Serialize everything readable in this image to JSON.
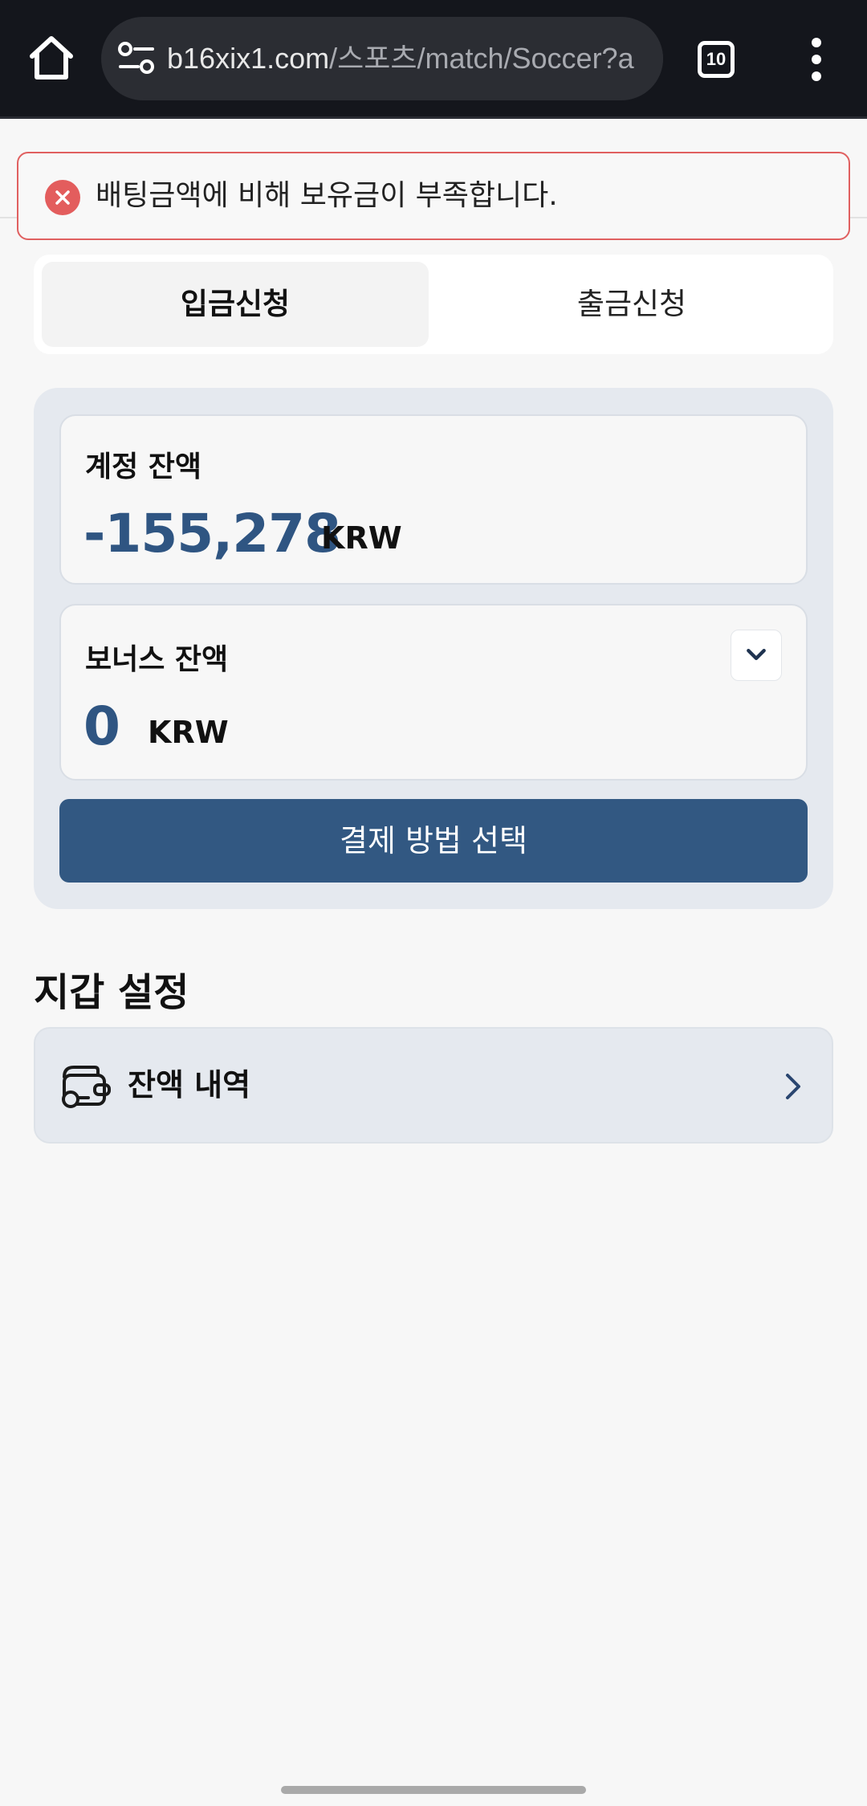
{
  "browser": {
    "url_host": "b16xix1.com",
    "url_path": "/스포츠/match/Soccer?a",
    "tab_count": "10",
    "icons": [
      "home-icon",
      "site-settings-icon",
      "tabs-icon",
      "more-menu-icon"
    ]
  },
  "alert": {
    "message": "배팅금액에 비해 보유금이 부족합니다.",
    "icon": "error-close-icon",
    "color": "#e35d5d"
  },
  "tabs": {
    "deposit": "입금신청",
    "withdraw": "출금신청",
    "active": "deposit"
  },
  "account_balance": {
    "label": "계정 잔액",
    "amount": "-155,278",
    "currency": "KRW"
  },
  "bonus_balance": {
    "label": "보너스 잔액",
    "amount": "0",
    "currency": "KRW",
    "icon": "chevron-down-icon"
  },
  "payment_button": "결제 방법 선택",
  "wallet_settings": {
    "title": "지갑 설정",
    "items": [
      {
        "label": "잔액 내역",
        "icon": "wallet-icon"
      }
    ]
  },
  "colors": {
    "accent": "#325882",
    "amount": "#2f5582",
    "panel": "#e5e9ef",
    "error": "#e06060"
  }
}
